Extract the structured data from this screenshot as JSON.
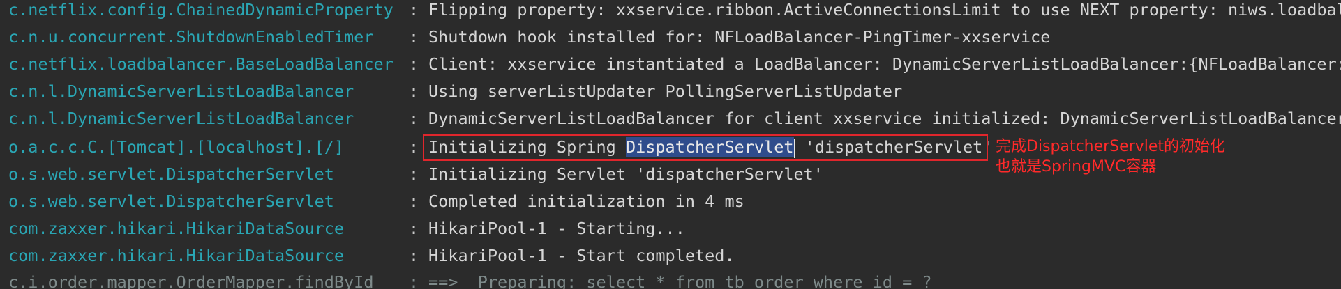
{
  "log_lines": [
    {
      "logger": "c.netflix.config.ChainedDynamicProperty",
      "separator": ":",
      "message": "Flipping property: xxservice.ribbon.ActiveConnectionsLimit to use NEXT property: niws.loadbala"
    },
    {
      "logger": "c.n.u.concurrent.ShutdownEnabledTimer",
      "separator": ":",
      "message": "Shutdown hook installed for: NFLoadBalancer-PingTimer-xxservice"
    },
    {
      "logger": "c.netflix.loadbalancer.BaseLoadBalancer",
      "separator": ":",
      "message": "Client: xxservice instantiated a LoadBalancer: DynamicServerListLoadBalancer:{NFLoadBalancer:n"
    },
    {
      "logger": "c.n.l.DynamicServerListLoadBalancer",
      "separator": ":",
      "message": "Using serverListUpdater PollingServerListUpdater"
    },
    {
      "logger": "c.n.l.DynamicServerListLoadBalancer",
      "separator": ":",
      "message": "DynamicServerListLoadBalancer for client xxservice initialized: DynamicServerListLoadBalancer:"
    },
    {
      "logger": "o.a.c.c.C.[Tomcat].[localhost].[/]",
      "separator": ":",
      "message_prefix": "Initializing Spring ",
      "message_selected": "DispatcherServlet",
      "message_suffix": " 'dispatcherServlet'"
    },
    {
      "logger": "o.s.web.servlet.DispatcherServlet",
      "separator": ":",
      "message": "Initializing Servlet 'dispatcherServlet'"
    },
    {
      "logger": "o.s.web.servlet.DispatcherServlet",
      "separator": ":",
      "message": "Completed initialization in 4 ms"
    },
    {
      "logger": "com.zaxxer.hikari.HikariDataSource",
      "separator": ":",
      "message": "HikariPool-1 - Starting..."
    },
    {
      "logger": "com.zaxxer.hikari.HikariDataSource",
      "separator": ":",
      "message": "HikariPool-1 - Start completed."
    },
    {
      "logger": "c.i.order.mapper.OrderMapper.findById",
      "separator": ":",
      "message": "==>  Preparing: select * from tb_order where id = ?"
    }
  ],
  "annotation": {
    "line1": "完成DispatcherServlet的初始化",
    "line2": "也就是SpringMVC容器"
  },
  "colors": {
    "background": "#2b2b2b",
    "logger": "#2aa6b4",
    "message": "#d6d6d6",
    "selection": "#2f4c8c",
    "annotation": "#ff2a2a"
  }
}
